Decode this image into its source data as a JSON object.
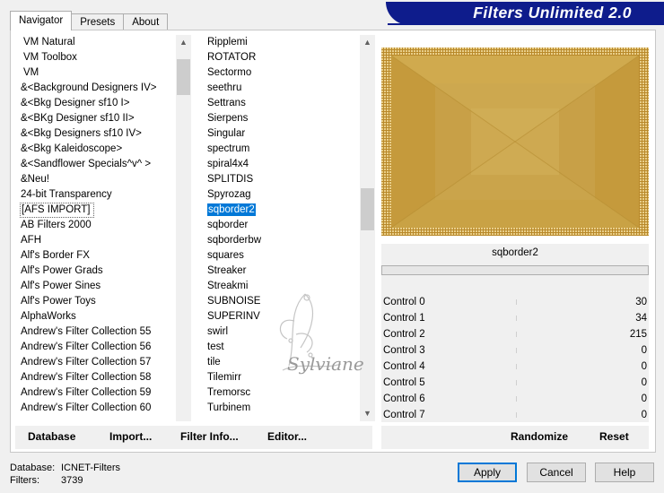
{
  "tabs": [
    "Navigator",
    "Presets",
    "About"
  ],
  "banner_title": "Filters Unlimited 2.0",
  "categories": [
    "VM Natural",
    "VM Toolbox",
    "VM",
    "&<Background Designers IV>",
    "&<Bkg Designer sf10 I>",
    "&<BKg Designer sf10 II>",
    "&<Bkg Designers sf10 IV>",
    "&<Bkg Kaleidoscope>",
    "&<Sandflower Specials^v^ >",
    "&Neu!",
    "24-bit Transparency",
    "[AFS IMPORT]",
    "AB Filters 2000",
    "AFH",
    "Alf's Border FX",
    "Alf's Power Grads",
    "Alf's Power Sines",
    "Alf's Power Toys",
    "AlphaWorks",
    "Andrew's Filter Collection 55",
    "Andrew's Filter Collection 56",
    "Andrew's Filter Collection 57",
    "Andrew's Filter Collection 58",
    "Andrew's Filter Collection 59",
    "Andrew's Filter Collection 60"
  ],
  "selected_category": "[AFS IMPORT]",
  "filters": [
    "Ripplemi",
    "ROTATOR",
    "Sectormo",
    "seethru",
    "Settrans",
    "Sierpens",
    "Singular",
    "spectrum",
    "spiral4x4",
    "SPLITDIS",
    "Spyrozag",
    "sqborder2",
    "sqborder",
    "sqborderbw",
    "squares",
    "Streaker",
    "Streakmi",
    "SUBNOISE",
    "SUPERINV",
    "swirl",
    "test",
    "tile",
    "Tilemirr",
    "Tremorsc",
    "Turbinem"
  ],
  "selected_filter": "sqborder2",
  "filter_name": "sqborder2",
  "controls": [
    {
      "label": "Control 0",
      "value": "30"
    },
    {
      "label": "Control 1",
      "value": "34"
    },
    {
      "label": "Control 2",
      "value": "215"
    },
    {
      "label": "Control 3",
      "value": "0"
    },
    {
      "label": "Control 4",
      "value": "0"
    },
    {
      "label": "Control 5",
      "value": "0"
    },
    {
      "label": "Control 6",
      "value": "0"
    },
    {
      "label": "Control 7",
      "value": "0"
    }
  ],
  "toolbar": {
    "database": "Database",
    "import": "Import...",
    "filter_info": "Filter Info...",
    "editor": "Editor...",
    "randomize": "Randomize",
    "reset": "Reset"
  },
  "status": {
    "database_label": "Database:",
    "database_value": "ICNET-Filters",
    "filters_label": "Filters:",
    "filters_value": "3739"
  },
  "buttons": {
    "apply": "Apply",
    "cancel": "Cancel",
    "help": "Help"
  },
  "watermark": "Sylviane",
  "colors": {
    "selection": "#0078d7",
    "preview_gold": "#c49a3a",
    "banner_blue": "#0e1c8c"
  }
}
